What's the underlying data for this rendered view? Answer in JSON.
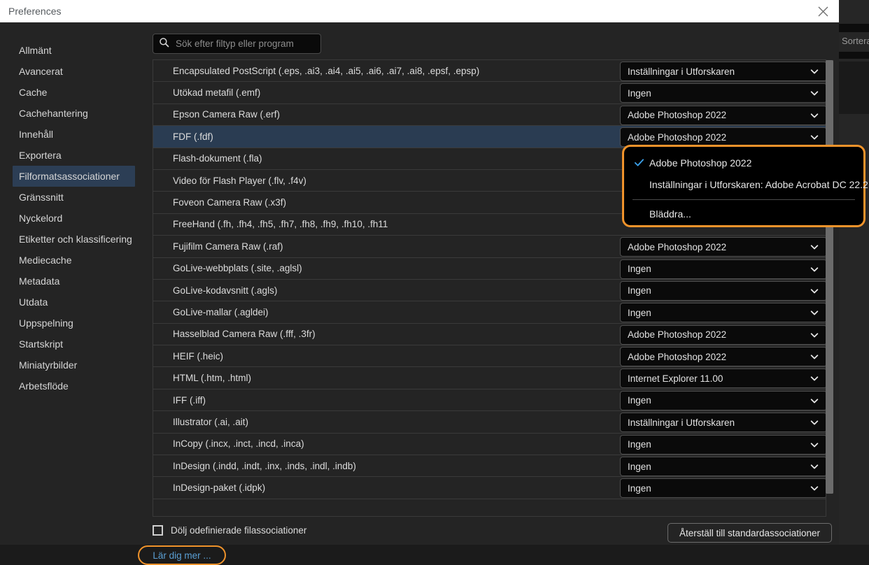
{
  "window": {
    "title": "Preferences",
    "close_icon": "close-icon"
  },
  "background": {
    "sortera_label": "Sortera"
  },
  "sidebar": {
    "items": [
      {
        "label": "Allmänt",
        "selected": false
      },
      {
        "label": "Avancerat",
        "selected": false
      },
      {
        "label": "Cache",
        "selected": false
      },
      {
        "label": "Cachehantering",
        "selected": false
      },
      {
        "label": "Innehåll",
        "selected": false
      },
      {
        "label": "Exportera",
        "selected": false
      },
      {
        "label": "Filformatsassociationer",
        "selected": true
      },
      {
        "label": "Gränssnitt",
        "selected": false
      },
      {
        "label": "Nyckelord",
        "selected": false
      },
      {
        "label": "Etiketter och klassificering",
        "selected": false
      },
      {
        "label": "Mediecache",
        "selected": false
      },
      {
        "label": "Metadata",
        "selected": false
      },
      {
        "label": "Utdata",
        "selected": false
      },
      {
        "label": "Uppspelning",
        "selected": false
      },
      {
        "label": "Startskript",
        "selected": false
      },
      {
        "label": "Miniatyrbilder",
        "selected": false
      },
      {
        "label": "Arbetsflöde",
        "selected": false
      }
    ]
  },
  "search": {
    "placeholder": "Sök efter filtyp eller program",
    "value": "",
    "icon": "search-icon"
  },
  "associations": {
    "rows": [
      {
        "filetype": "Encapsulated PostScript (.eps, .ai3, .ai4, .ai5, .ai6, .ai7, .ai8, .epsf, .epsp)",
        "app": "Inställningar i Utforskaren",
        "selected": false
      },
      {
        "filetype": "Utökad metafil (.emf)",
        "app": "Ingen",
        "selected": false
      },
      {
        "filetype": "Epson Camera Raw (.erf)",
        "app": "Adobe Photoshop 2022",
        "selected": false
      },
      {
        "filetype": "FDF (.fdf)",
        "app": "Adobe Photoshop 2022",
        "selected": true
      },
      {
        "filetype": "Flash-dokument (.fla)",
        "app": "",
        "selected": false
      },
      {
        "filetype": "Video för Flash Player (.flv, .f4v)",
        "app": "",
        "selected": false
      },
      {
        "filetype": "Foveon Camera Raw (.x3f)",
        "app": "",
        "selected": false
      },
      {
        "filetype": "FreeHand (.fh, .fh4, .fh5, .fh7, .fh8, .fh9, .fh10, .fh11",
        "app": "",
        "selected": false
      },
      {
        "filetype": "Fujifilm Camera Raw (.raf)",
        "app": "Adobe Photoshop 2022",
        "selected": false
      },
      {
        "filetype": "GoLive-webbplats (.site, .aglsl)",
        "app": "Ingen",
        "selected": false
      },
      {
        "filetype": "GoLive-kodavsnitt (.agls)",
        "app": "Ingen",
        "selected": false
      },
      {
        "filetype": "GoLive-mallar (.agldei)",
        "app": "Ingen",
        "selected": false
      },
      {
        "filetype": "Hasselblad Camera Raw (.fff, .3fr)",
        "app": "Adobe Photoshop 2022",
        "selected": false
      },
      {
        "filetype": "HEIF (.heic)",
        "app": "Adobe Photoshop 2022",
        "selected": false
      },
      {
        "filetype": "HTML (.htm, .html)",
        "app": "Internet Explorer 11.00",
        "selected": false
      },
      {
        "filetype": "IFF (.iff)",
        "app": "Ingen",
        "selected": false
      },
      {
        "filetype": "Illustrator (.ai, .ait)",
        "app": "Inställningar i Utforskaren",
        "selected": false
      },
      {
        "filetype": "InCopy (.incx, .inct, .incd, .inca)",
        "app": "Ingen",
        "selected": false
      },
      {
        "filetype": "InDesign (.indd, .indt, .inx, .inds, .indl, .indb)",
        "app": "Ingen",
        "selected": false
      },
      {
        "filetype": "InDesign-paket (.idpk)",
        "app": "Ingen",
        "selected": false
      }
    ]
  },
  "dropdown": {
    "open": true,
    "items": [
      {
        "label": "Adobe Photoshop 2022",
        "checked": true
      },
      {
        "label": "Inställningar i Utforskaren: Adobe Acrobat DC 22.2",
        "checked": false
      }
    ],
    "browse_label": "Bläddra...",
    "highlight_color": "#f0932b",
    "check_color": "#3a9fe8"
  },
  "footer": {
    "hide_undefined_label": "Dölj odefinierade filassociationer",
    "hide_undefined_checked": false,
    "learn_more_label": "Lär dig mer ...",
    "reset_label": "Återställ till standardassociationer"
  },
  "colors": {
    "accent_orange": "#f0932b",
    "link_blue": "#5a9fd4",
    "row_selected": "#2a3c52",
    "sidebar_selected": "#2c3e55"
  }
}
